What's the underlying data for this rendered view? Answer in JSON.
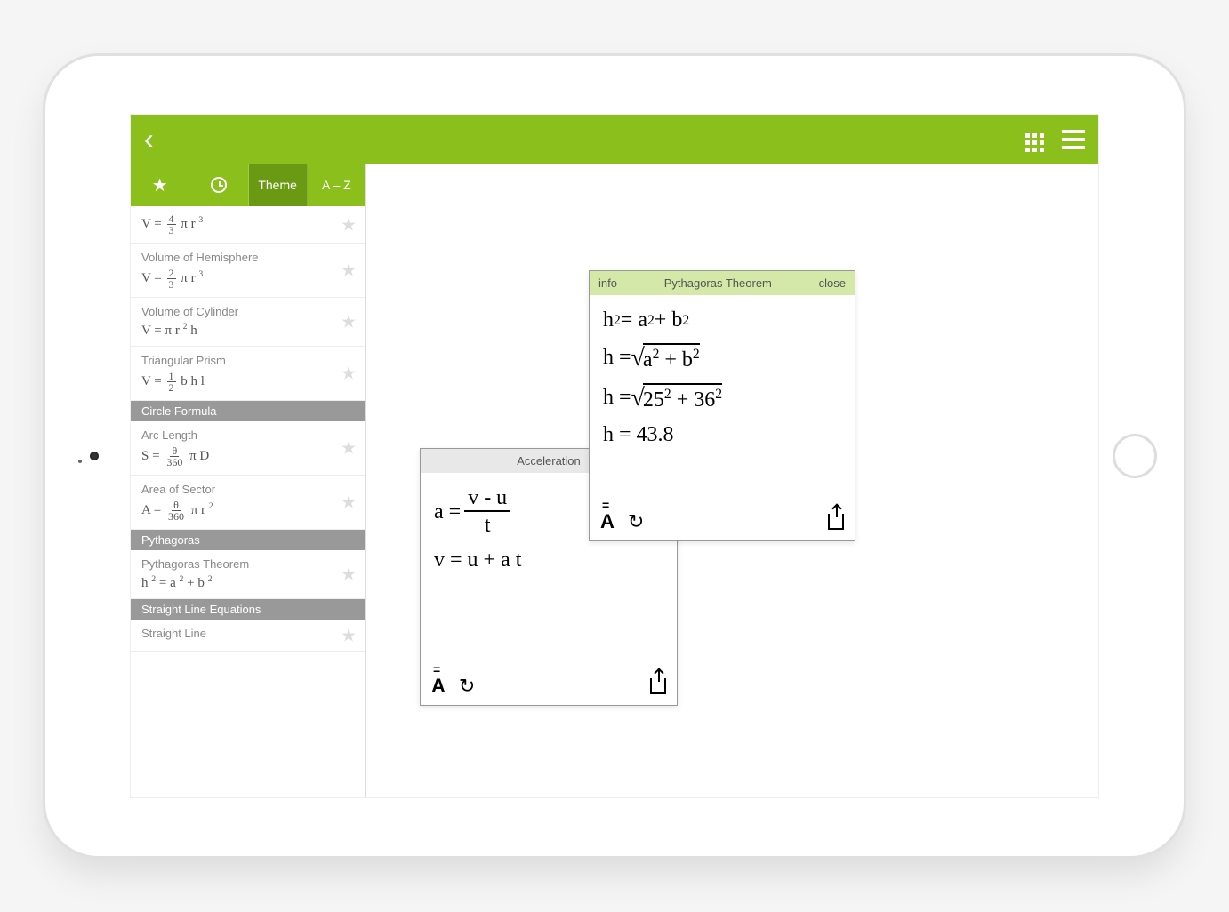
{
  "header": {
    "back": "‹"
  },
  "tabs": {
    "star": "★",
    "theme": "Theme",
    "az": "A – Z"
  },
  "sidebar": [
    {
      "type": "item",
      "title": "",
      "formula_html": "V = <frac>4|3</frac> π r <sup>3</sup>"
    },
    {
      "type": "item",
      "title": "Volume of Hemisphere",
      "formula_html": "V = <frac>2|3</frac> π r <sup>3</sup>"
    },
    {
      "type": "item",
      "title": "Volume of Cylinder",
      "formula_html": "V = π r <sup>2</sup> h"
    },
    {
      "type": "item",
      "title": "Triangular Prism",
      "formula_html": "V = <frac>1|2</frac> b h l"
    },
    {
      "type": "section",
      "title": "Circle Formula"
    },
    {
      "type": "item",
      "title": "Arc Length",
      "formula_html": "S = <frac>θ|360</frac> π D"
    },
    {
      "type": "item",
      "title": "Area of Sector",
      "formula_html": "A = <frac>θ|360</frac> π r <sup>2</sup>"
    },
    {
      "type": "section",
      "title": "Pythagoras"
    },
    {
      "type": "item",
      "title": "Pythagoras Theorem",
      "formula_html": "h <sup>2</sup> = a <sup>2</sup> + b <sup>2</sup>"
    },
    {
      "type": "section",
      "title": "Straight Line Equations"
    },
    {
      "type": "item",
      "title": "Straight Line",
      "formula_html": ""
    }
  ],
  "card_acceleration": {
    "title": "Acceleration",
    "line1": "a = (v - u) / t",
    "line2": "v = u + a t"
  },
  "card_pythagoras": {
    "info": "info",
    "title": "Pythagoras Theorem",
    "close": "close",
    "lines": [
      "h² = a² + b²",
      "h = √(a² + b²)",
      "h = √(25² + 36²)",
      "h = 43.8"
    ],
    "values": {
      "a": 25,
      "b": 36,
      "h": 43.8
    }
  }
}
